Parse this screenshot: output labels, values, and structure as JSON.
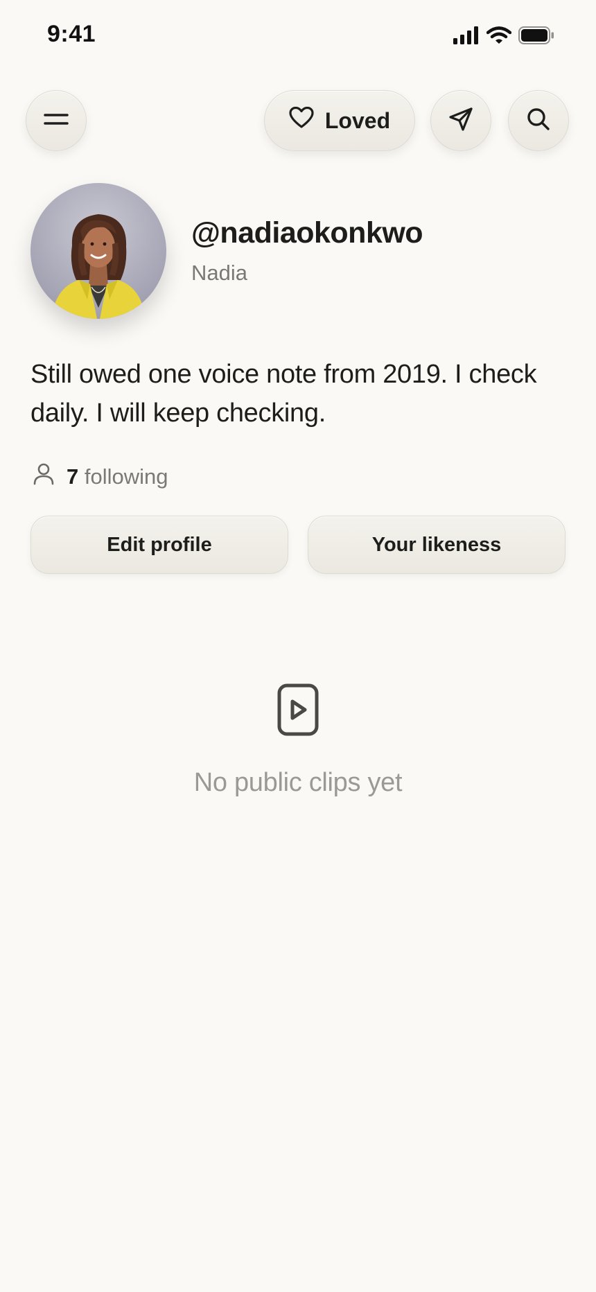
{
  "status_bar": {
    "time": "9:41"
  },
  "top_bar": {
    "menu_icon": "menu-icon",
    "loved_label": "Loved",
    "heart_icon": "heart-icon",
    "send_icon": "send-icon",
    "search_icon": "search-icon"
  },
  "profile": {
    "username": "@nadiaokonkwo",
    "display_name": "Nadia",
    "bio": "Still owed one voice note from 2019. I check daily. I will keep checking.",
    "following_count": "7",
    "following_label": "following"
  },
  "actions": {
    "edit_profile": "Edit profile",
    "your_likeness": "Your likeness"
  },
  "empty_state": {
    "icon": "video-play-icon",
    "message": "No public clips yet"
  },
  "colors": {
    "background": "#faf9f6",
    "button_bg": "#efece6",
    "text_primary": "#1d1d1b",
    "text_secondary": "#7a7975",
    "text_muted": "#9b9995",
    "avatar_jacket": "#e8d43a"
  }
}
